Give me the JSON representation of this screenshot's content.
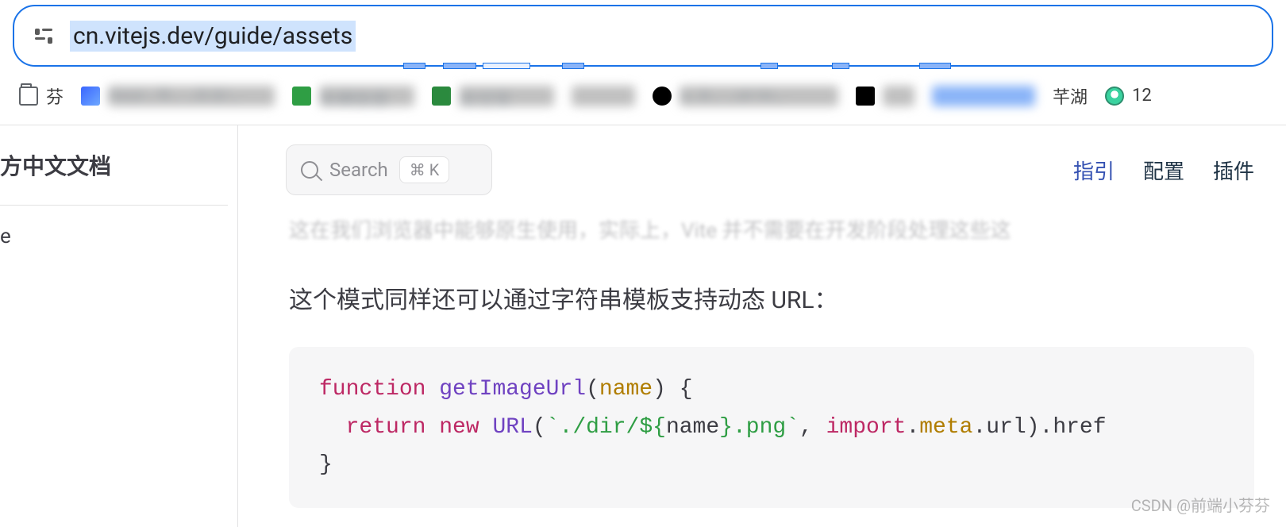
{
  "browser": {
    "url": "cn.vitejs.dev/guide/assets"
  },
  "bookmarks": {
    "b0": "芬",
    "b1": "Axur… R… …0.3/…",
    "b2": "车辆信息",
    "b3": "支付宝",
    "b4": "",
    "b5": "u…k… …or m…",
    "b6": "",
    "b7": "",
    "b8": "芊湖",
    "b9": "12"
  },
  "sidebar": {
    "title": "方中文文档",
    "item0": "e"
  },
  "search": {
    "label": "Search",
    "kbd": "⌘ K"
  },
  "nav": {
    "guide": "指引",
    "config": "配置",
    "plugins": "插件"
  },
  "content": {
    "faded": "这在我们浏览器中能够原生使用，实际上，Vite 并不需要在开发阶段处理这些这",
    "para": "这个模式同样还可以通过字符串模板支持动态 URL："
  },
  "code": {
    "kw_function": "function",
    "fn_name": "getImageUrl",
    "param": "name",
    "brace_open": "{",
    "kw_return": "return",
    "kw_new": "new",
    "cls_url": "URL",
    "tmpl_open": "`./dir/${",
    "tmpl_var": "name",
    "tmpl_close": "}.png`",
    "comma_sp": ", ",
    "kw_import": "import",
    "dot1": ".",
    "meta": "meta",
    "dot2": ".",
    "prop_url": "url",
    "paren_close": ")",
    "dot3": ".",
    "prop_href": "href",
    "brace_close": "}"
  },
  "watermark": "CSDN @前端小芬芬"
}
